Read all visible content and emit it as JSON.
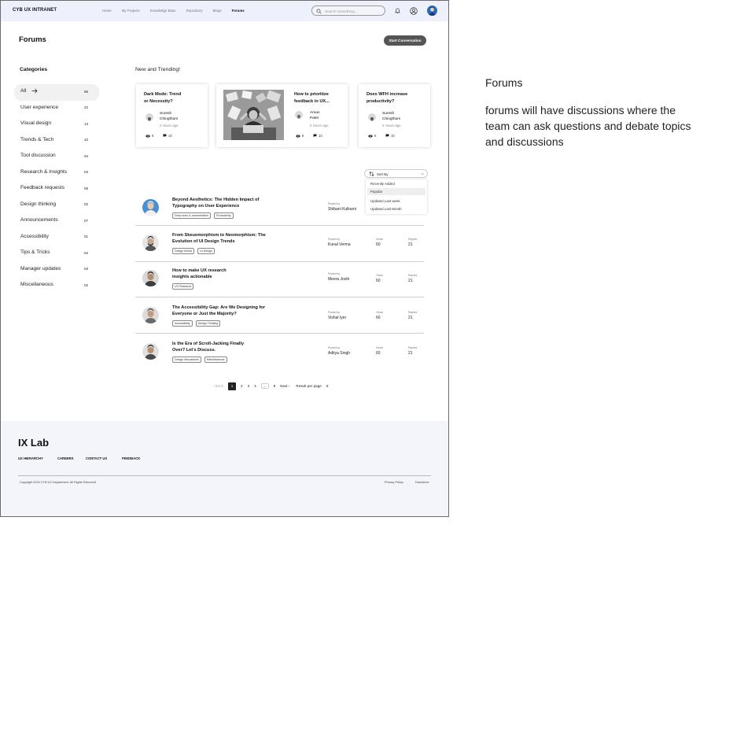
{
  "nav": {
    "brand": "CYB UX INTRANET",
    "links": [
      "Home",
      "My Projects",
      "Knowledge Base",
      "Repository",
      "Blogs",
      "Forums"
    ],
    "active_index": 5,
    "search_placeholder": "Search Something..."
  },
  "page": {
    "title": "Forums",
    "start_button": "Start Conversation"
  },
  "categories": {
    "title": "Categories",
    "items": [
      {
        "label": "All",
        "count": "65"
      },
      {
        "label": "User experience",
        "count": "22"
      },
      {
        "label": "Visual design",
        "count": "13"
      },
      {
        "label": "Trends & Tech",
        "count": "10"
      },
      {
        "label": "Tool discussion",
        "count": "04"
      },
      {
        "label": "Research & Insights",
        "count": "03"
      },
      {
        "label": "Feedback requests",
        "count": "06"
      },
      {
        "label": "Design thinking",
        "count": "02"
      },
      {
        "label": "Announcements",
        "count": "07"
      },
      {
        "label": "Accessibility",
        "count": "01"
      },
      {
        "label": "Tips & Tricks",
        "count": "04"
      },
      {
        "label": "Manager updates",
        "count": "03"
      },
      {
        "label": "Miscellaneous",
        "count": "02"
      }
    ]
  },
  "trending": {
    "title": "New and Trending!",
    "cards": [
      {
        "title_l1": "Dark Mode: Trend",
        "title_l2": "or Necessity?",
        "author_l1": "Suresh",
        "author_l2": "Chingtham",
        "time": "2 Hours ago",
        "views": "6",
        "replies": "10"
      },
      {
        "title_l1": "How to prioritize",
        "title_l2": "feedback in UX...",
        "author_l1": "Aman",
        "author_l2": "Patel",
        "time": "2 Hours ago",
        "views": "6",
        "replies": "10"
      },
      {
        "title_l1": "Does WFH increase",
        "title_l2": "productivity?",
        "author_l1": "Suresh",
        "author_l2": "Chingtham",
        "time": "2 Hours ago",
        "views": "6",
        "replies": "10"
      }
    ]
  },
  "sort": {
    "label": "Sort By",
    "options": [
      "Recently Added",
      "Popular",
      "Updated Last week",
      "Updated Last Month"
    ],
    "selected_index": 1
  },
  "posts": {
    "posted_by_label": "Posted by",
    "views_label": "Views",
    "replies_label": "Replies",
    "items": [
      {
        "title_l1": "Beyond Aesthetics: The Hidden Impact of",
        "title_l2": "Typography on User Experience",
        "tags": [
          "Deep work & concentration",
          "Productivity"
        ],
        "author": "Shibani Kulkarni",
        "views": "60",
        "replies": "21"
      },
      {
        "title_l1": "From Skeuomorphism to Neomorphism: The",
        "title_l2": "Evolution of UI Design Trends",
        "tags": [
          "Design trends",
          "UI Design"
        ],
        "author": "Kunal Verma",
        "views": "60",
        "replies": "21"
      },
      {
        "title_l1": "How to make UX research",
        "title_l2": "insights actionable",
        "tags": [
          "UX Research"
        ],
        "author": "Meera Joshi",
        "views": "60",
        "replies": "21"
      },
      {
        "title_l1": "The Accessibility Gap: Are We Designing for",
        "title_l2": "Everyone or Just the Majority?",
        "tags": [
          "Accessibility",
          "Design Thinking"
        ],
        "author": "Vishal Iyer",
        "views": "60",
        "replies": "21"
      },
      {
        "title_l1": "Is the Era of Scroll-Jacking Finally",
        "title_l2": "Over? Let's Discuss.",
        "tags": [
          "Design discussions",
          "Miscellaneous"
        ],
        "author": "Aditya Singh",
        "views": "60",
        "replies": "21"
      }
    ]
  },
  "pagination": {
    "back": "‹ Back",
    "pages": [
      "1",
      "2",
      "3",
      "4"
    ],
    "ellipsis": "...",
    "last": "8",
    "next": "Next ›",
    "per_page_label": "Result per page",
    "per_page_value": "8",
    "current": "1"
  },
  "footer": {
    "logo": "IX Lab",
    "links": [
      "UX HIERARCHY",
      "CAREERS",
      "CONTACT US",
      "FEEDBACK"
    ],
    "copyright": "Copyright 2024 CYB UX Department. All Rights Reserved",
    "privacy": "Privacy Policy",
    "disclaimer": "Disclaimer"
  },
  "annotation": {
    "title": "Forums",
    "body": "forums will have discussions where the team can ask questions and debate topics and discussions"
  },
  "colors": {
    "nav_bg": "#eef0fb",
    "footer_bg": "#f4f5fb",
    "button_bg": "#555555",
    "avatar_blue": "#2a6ab8"
  }
}
